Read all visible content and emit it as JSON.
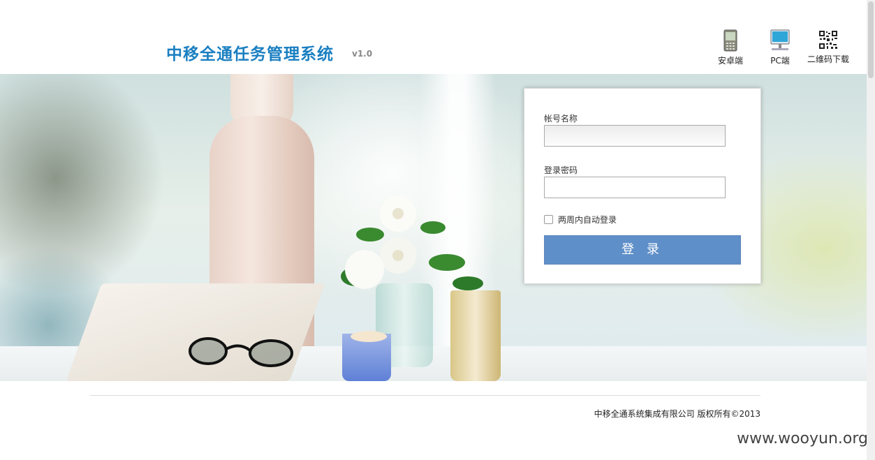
{
  "header": {
    "title": "中移全通任务管理系统",
    "version": "v1.0",
    "downloads": [
      {
        "label": "安卓端",
        "icon": "android-phone-icon"
      },
      {
        "label": "PC端",
        "icon": "pc-monitor-icon"
      },
      {
        "label": "二维码下载",
        "icon": "qr-code-icon"
      }
    ]
  },
  "login": {
    "username_label": "帐号名称",
    "username_value": "",
    "password_label": "登录密码",
    "password_value": "",
    "remember_label": "两周内自动登录",
    "remember_checked": false,
    "submit_label": "登 录"
  },
  "footer": {
    "copyright": "中移全通系统集成有限公司 版权所有©2013"
  },
  "watermark": "www.wooyun.org",
  "colors": {
    "title": "#1a7fc1",
    "login_button": "#5f8fc9"
  }
}
